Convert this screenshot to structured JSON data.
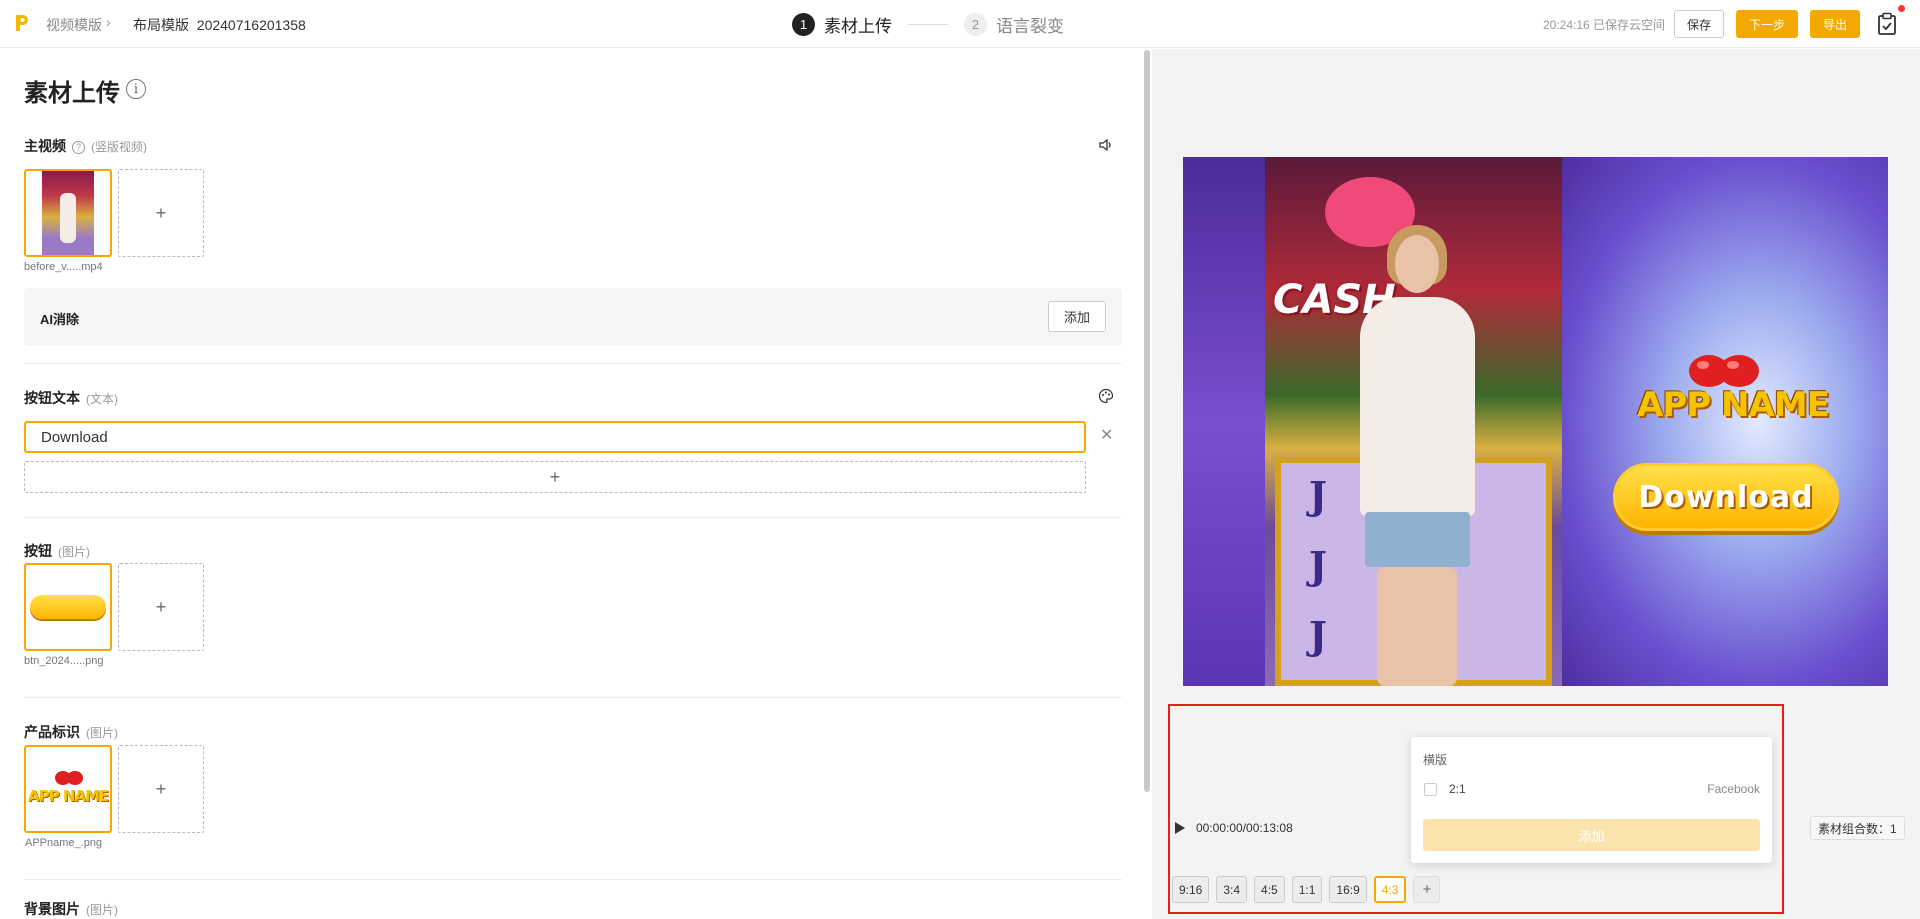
{
  "header": {
    "breadcrumb": [
      "视频模版",
      "布局模版"
    ],
    "breadcrumb_sep": "›",
    "project_name": "20240716201358",
    "steps": [
      {
        "num": "1",
        "label": "素材上传"
      },
      {
        "num": "2",
        "label": "语言裂变"
      }
    ],
    "save_status": "20:24:16 已保存云空间",
    "save_label": "保存",
    "next_label": "下一步",
    "export_label": "导出"
  },
  "left": {
    "title": "素材上传",
    "main_video": {
      "label": "主视频",
      "sub": "(竖版视频)",
      "filename": "before_v.....mp4"
    },
    "ai_erase": {
      "label": "AI消除",
      "button": "添加"
    },
    "button_text": {
      "label": "按钮文本",
      "sub": "(文本)",
      "value": "Download"
    },
    "button_image": {
      "label": "按钮",
      "sub": "(图片)",
      "filename": "btn_2024.....png"
    },
    "logo": {
      "label": "产品标识",
      "sub": "(图片)",
      "filename": "APPname_.png"
    },
    "background": {
      "label": "背景图片",
      "sub": "(图片)"
    }
  },
  "preview": {
    "app_name": "APP NAME",
    "button_text": "Download",
    "slot_text": "CASH",
    "reel_symbol": "J",
    "time": "00:00:00/00:13:08",
    "combo_count": "素材组合数：1",
    "ratios": [
      "9:16",
      "3:4",
      "4:5",
      "1:1",
      "16:9",
      "4:3"
    ],
    "active_ratio": "4:3"
  },
  "popup": {
    "section": "横版",
    "ratio": "2:1",
    "platform": "Facebook",
    "add_label": "添加"
  },
  "colors": {
    "accent": "#f5a800",
    "highlight": "#e81e1e"
  }
}
